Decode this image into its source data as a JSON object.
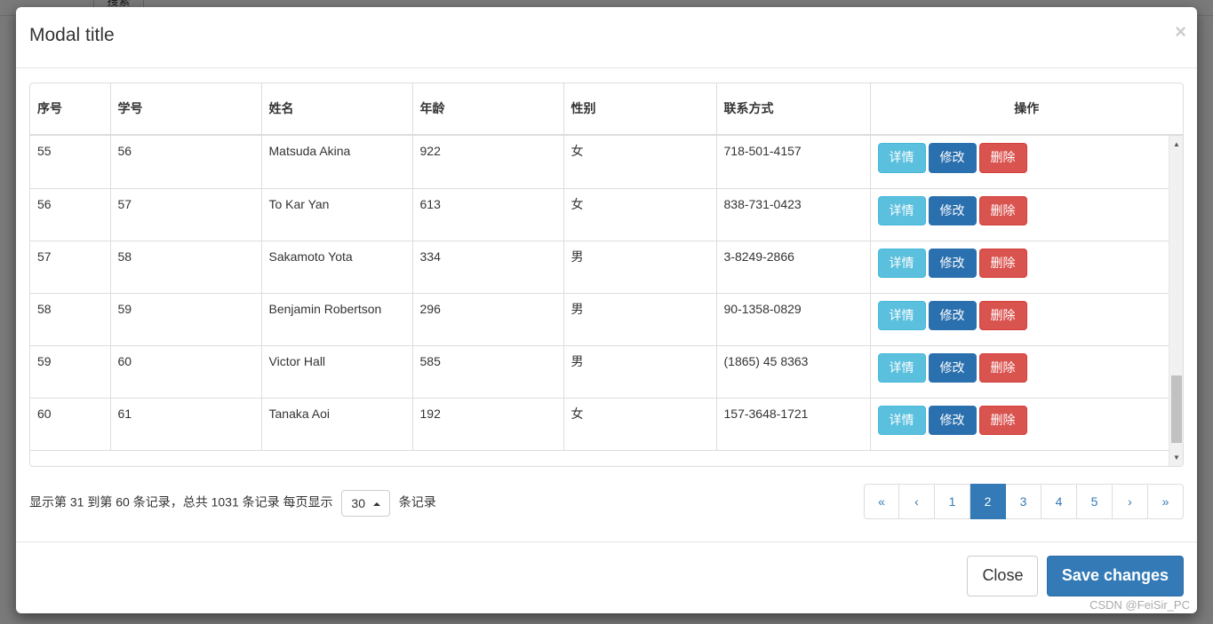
{
  "background": {
    "search_button_label": "搜索"
  },
  "modal": {
    "title": "Modal title",
    "close_icon_label": "×",
    "table": {
      "columns": [
        {
          "key": "seq",
          "label": "序号"
        },
        {
          "key": "sid",
          "label": "学号"
        },
        {
          "key": "name",
          "label": "姓名"
        },
        {
          "key": "age",
          "label": "年龄"
        },
        {
          "key": "sex",
          "label": "性别"
        },
        {
          "key": "tel",
          "label": "联系方式"
        },
        {
          "key": "op",
          "label": "操作"
        }
      ],
      "rows": [
        {
          "seq": "55",
          "sid": "56",
          "name": "Matsuda Akina",
          "age": "922",
          "sex": "女",
          "tel": "718-501-4157"
        },
        {
          "seq": "56",
          "sid": "57",
          "name": "To Kar Yan",
          "age": "613",
          "sex": "女",
          "tel": "838-731-0423"
        },
        {
          "seq": "57",
          "sid": "58",
          "name": "Sakamoto Yota",
          "age": "334",
          "sex": "男",
          "tel": "3-8249-2866"
        },
        {
          "seq": "58",
          "sid": "59",
          "name": "Benjamin Robertson",
          "age": "296",
          "sex": "男",
          "tel": "90-1358-0829"
        },
        {
          "seq": "59",
          "sid": "60",
          "name": "Victor Hall",
          "age": "585",
          "sex": "男",
          "tel": "(1865) 45 8363"
        },
        {
          "seq": "60",
          "sid": "61",
          "name": "Tanaka Aoi",
          "age": "192",
          "sex": "女",
          "tel": "157-3648-1721"
        }
      ],
      "row_actions": {
        "detail_label": "详情",
        "edit_label": "修改",
        "delete_label": "删除"
      }
    },
    "pagination": {
      "info_prefix": "显示第 31 到第 60 条记录，总共 1031 条记录 每页显示",
      "page_size_value": "30",
      "info_suffix": "条记录",
      "pages": [
        {
          "label": "«",
          "name": "first",
          "active": false
        },
        {
          "label": "‹",
          "name": "prev",
          "active": false
        },
        {
          "label": "1",
          "name": "page-1",
          "active": false
        },
        {
          "label": "2",
          "name": "page-2",
          "active": true
        },
        {
          "label": "3",
          "name": "page-3",
          "active": false
        },
        {
          "label": "4",
          "name": "page-4",
          "active": false
        },
        {
          "label": "5",
          "name": "page-5",
          "active": false
        },
        {
          "label": "›",
          "name": "next",
          "active": false
        },
        {
          "label": "»",
          "name": "last",
          "active": false
        }
      ]
    },
    "footer": {
      "close_label": "Close",
      "save_label": "Save changes"
    }
  },
  "watermark": "CSDN @FeiSir_PC",
  "colors": {
    "primary": "#337ab7",
    "info": "#5bc0de",
    "danger": "#d9534f",
    "edit_blue": "#2a6fae",
    "active_page": "#337ab7"
  }
}
